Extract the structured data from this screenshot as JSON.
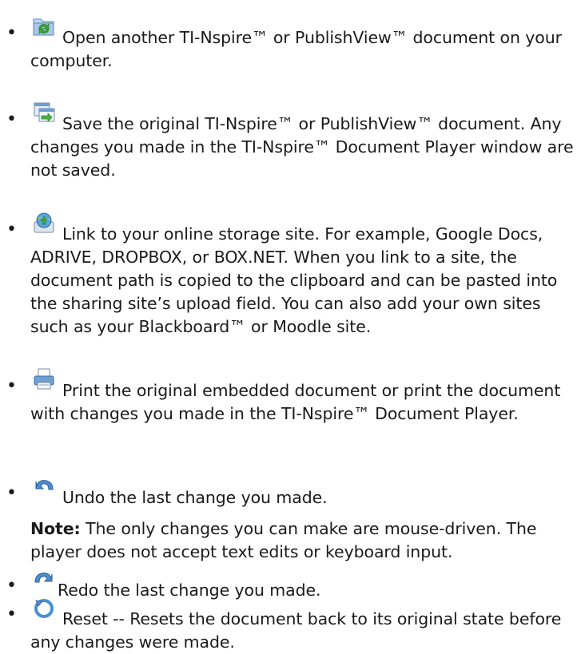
{
  "bullets": [
    {
      "icon": "open-folder-icon",
      "text": "Open another TI-Nspire™ or PublishView™ document on your computer."
    },
    {
      "icon": "save-original-icon",
      "text": "Save the original TI-Nspire™ or PublishView™ document. Any changes you made in the TI-Nspire™ Document Player window are not saved."
    },
    {
      "icon": "online-storage-icon",
      "text": "Link to your online storage site. For example, Google Docs, ADRIVE, DROPBOX, or BOX.NET. When you link to a site, the document path is copied to the clipboard and can be pasted into the sharing site’s upload field. You can also add your own sites such as your Blackboard™ or Moodle site."
    },
    {
      "icon": "print-icon",
      "text": "Print the original embedded document or print the document with changes you made in the TI-Nspire™ Document Player."
    },
    {
      "icon": "undo-icon",
      "text": "Undo the last change you made."
    },
    {
      "icon": "redo-icon",
      "text": "Redo the last change you made."
    },
    {
      "icon": "reset-icon",
      "text": "Reset -- Resets the document back to its original state before any changes were made."
    }
  ],
  "note": {
    "label": "Note:",
    "text": " The only changes you can make are mouse-driven. The player does not accept text edits or keyboard input."
  },
  "bullet_glyph": "•"
}
